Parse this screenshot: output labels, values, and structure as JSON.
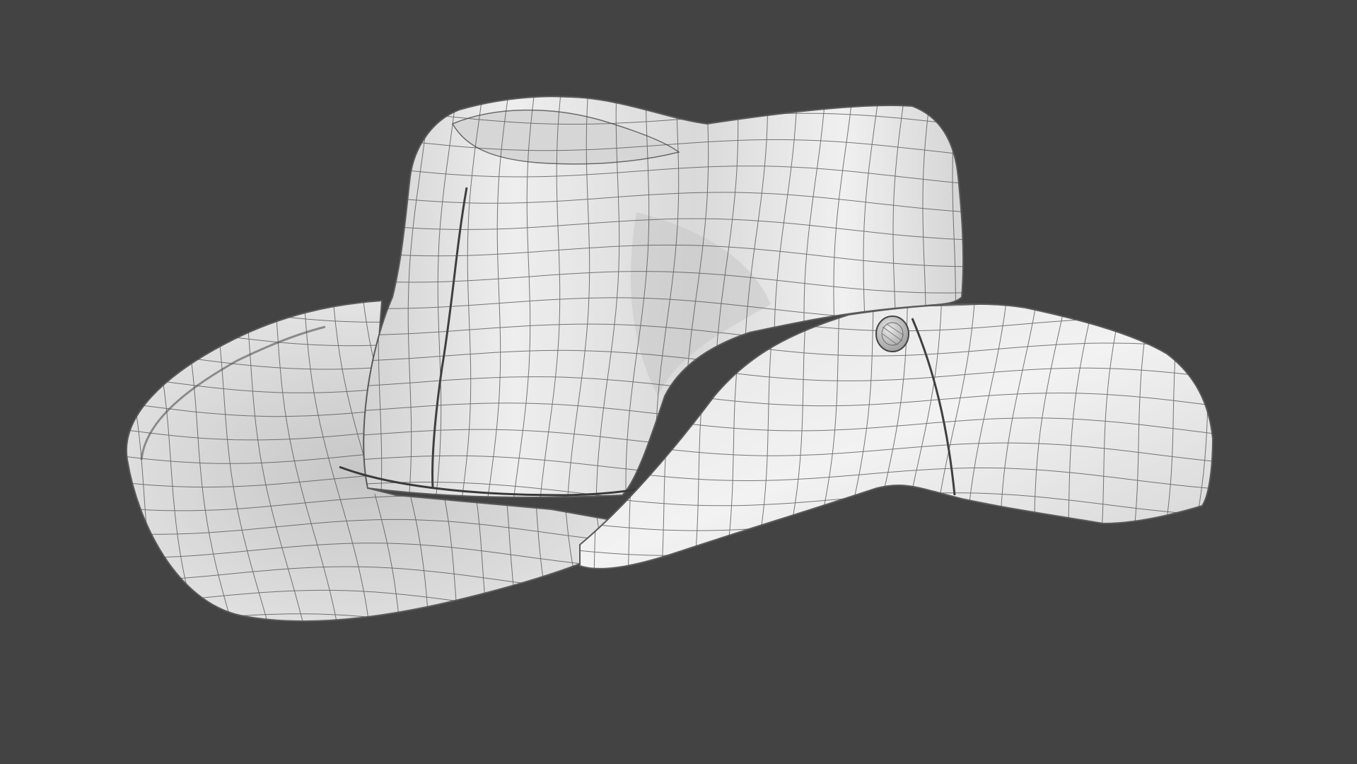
{
  "viewport": {
    "background_color": "#434343",
    "render_style": "clay shaded with wireframe overlay"
  },
  "subject": {
    "object": "hat-3d-model",
    "parts": [
      "crown",
      "left-brim",
      "right-brim",
      "band",
      "button"
    ],
    "surface_color": "#e6e6e6",
    "wire_color": "#4a4a4a",
    "shade_color": "#b9b9b9"
  }
}
